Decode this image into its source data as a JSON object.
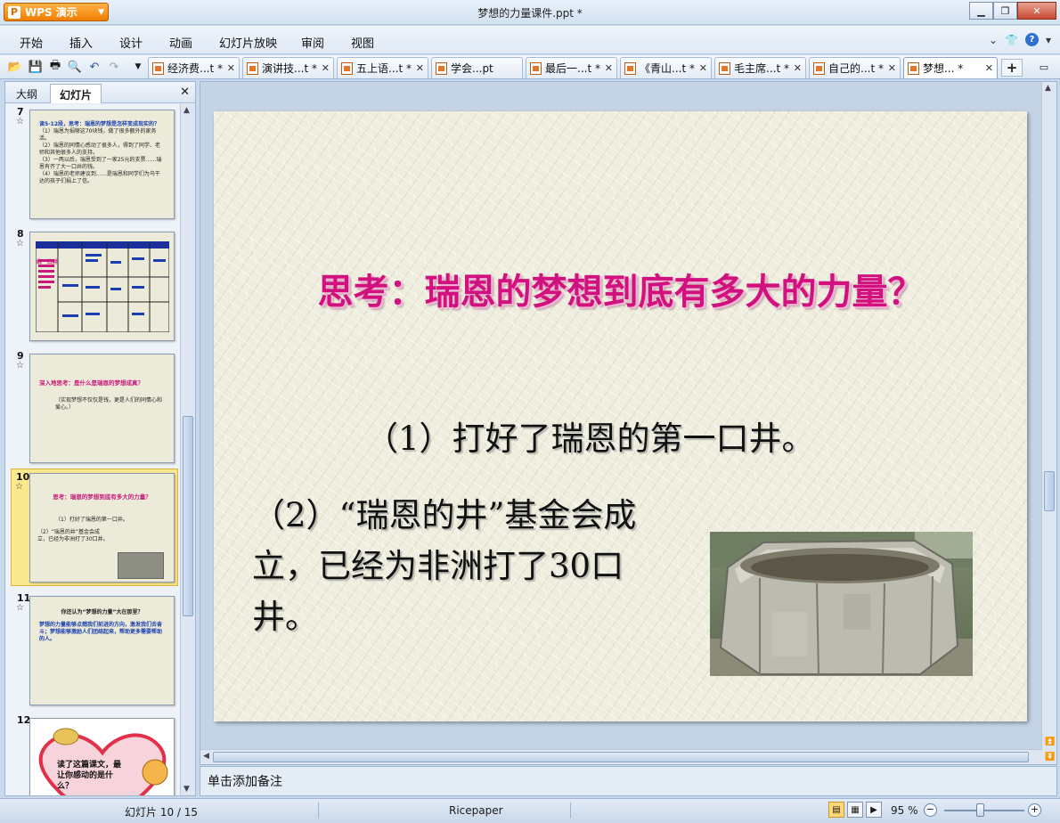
{
  "app": {
    "name": "WPS 演示",
    "window_title": "梦想的力量课件.ppt *"
  },
  "menu": [
    "开始",
    "插入",
    "设计",
    "动画",
    "幻灯片放映",
    "审阅",
    "视图"
  ],
  "tabs": [
    {
      "label": "经济费...t *"
    },
    {
      "label": "演讲技...t *"
    },
    {
      "label": "五上语...t *"
    },
    {
      "label": "学会...pt"
    },
    {
      "label": "最后一...t *"
    },
    {
      "label": "《青山...t *"
    },
    {
      "label": "毛主席...t *"
    },
    {
      "label": "自己的...t *"
    },
    {
      "label": "梦想... *"
    }
  ],
  "left_pane": {
    "tab_outline": "大纲",
    "tab_slides": "幻灯片",
    "slides": [
      {
        "num": "7",
        "lines": [
          "读5-12段，思考：瑞恩的梦想是怎样变成现实的？",
          "（1）瑞恩为捐够这70块钱，做了很多额外的家务活。",
          "（2）瑞恩的同情心感动了很多人，得到了同学、老师和其他很多人的支持。",
          "（3）一两以后，瑞恩受到了一家25元的支票……瑞恩有齐了大一口井的钱。",
          "（4）瑞恩的老师建议到……是瑞恩和同学们为乌干达的孩子们捐上了信。"
        ]
      },
      {
        "num": "8",
        "lines": [
          "统一口井"
        ]
      },
      {
        "num": "9",
        "lines": [
          "深入地思考：是什么是瑞恩的梦想成真？",
          "（实现梦想不仅仅是钱，更是人们的同情心和爱心。）"
        ]
      },
      {
        "num": "10",
        "lines": [
          "思考：瑞恩的梦想到底有多大的力量？",
          "（1）打好了瑞恩的第一口井。",
          "（2）“瑞恩的井”基金会成立，已经为非洲打了30口井。"
        ]
      },
      {
        "num": "11",
        "lines": [
          "你还认为“梦想的力量”大在那里？",
          "梦想的力量能够点燃我们前进的方向，激发我们去奋斗；梦想能够激励人们团结起来，帮助更多需要帮助的人。"
        ]
      },
      {
        "num": "12",
        "lines": [
          "读了这篇课文，最让你感动的是什么？"
        ]
      }
    ]
  },
  "slide": {
    "title": "思考：瑞恩的梦想到底有多大的力量？",
    "line1": "（1）打好了瑞恩的第一口井。",
    "line2": "（2）“瑞恩的井”基金会成立，已经为非洲打了30口井。"
  },
  "notes_placeholder": "单击添加备注",
  "status": {
    "slide_indicator": "幻灯片 10 / 15",
    "theme": "Ricepaper",
    "zoom": "95 %"
  }
}
